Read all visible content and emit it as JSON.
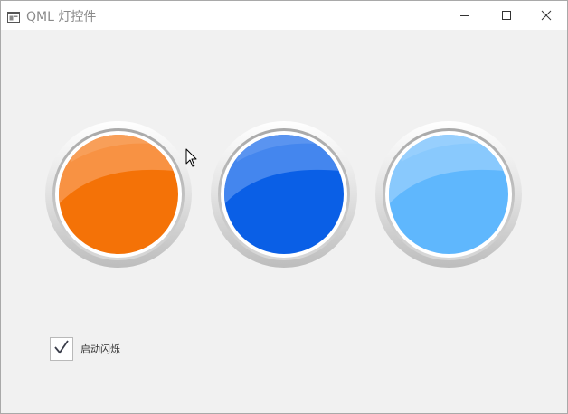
{
  "window": {
    "title": "QML 灯控件"
  },
  "icons": {
    "app": "app-window-icon",
    "minimize": "minimize-icon",
    "maximize": "maximize-icon",
    "close": "close-icon",
    "check": "checkmark-icon",
    "cursor": "mouse-pointer-icon"
  },
  "lamps": [
    {
      "name": "orange-lamp",
      "color": "#f47207",
      "highlight": "#f8964a"
    },
    {
      "name": "blue-lamp",
      "color": "#0a5fe6",
      "highlight": "#4a8bee"
    },
    {
      "name": "light-blue-lamp",
      "color": "#5fb7fd",
      "highlight": "#8ecbfd"
    }
  ],
  "blink_checkbox": {
    "label": "启动闪烁",
    "checked": true
  },
  "colors": {
    "window_bg": "#f1f1f1",
    "titlebar_bg": "#ffffff",
    "bezel_outer": "#c8c8c8",
    "bezel_inner": "#ffffff"
  }
}
